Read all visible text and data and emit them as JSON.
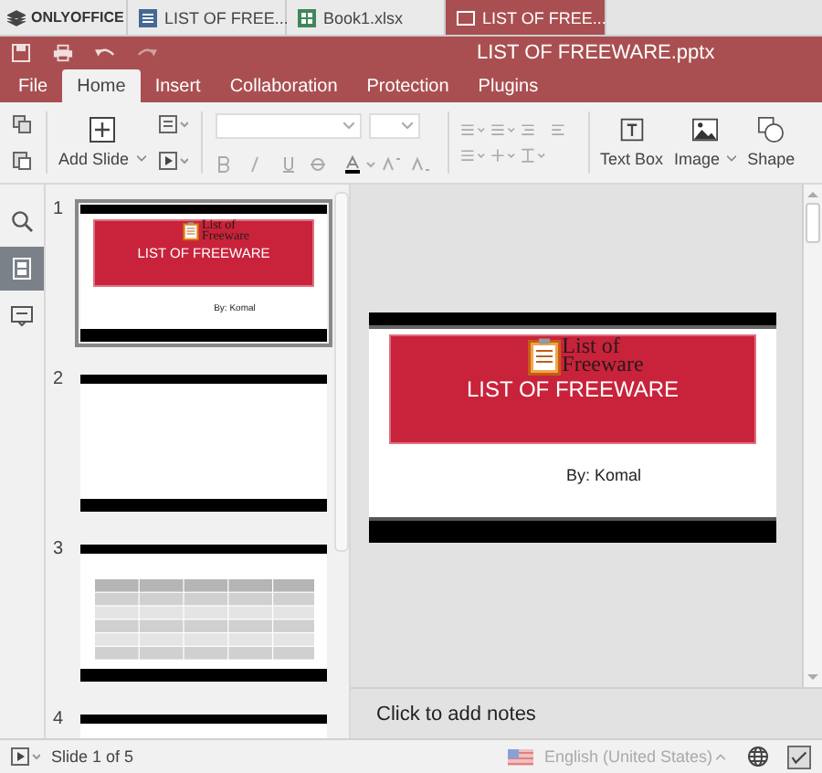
{
  "app_tabs": [
    {
      "label": "ONLYOFFICE",
      "kind": "home",
      "selected": false
    },
    {
      "label": "LIST OF FREE...",
      "kind": "document",
      "selected": false
    },
    {
      "label": "Book1.xlsx",
      "kind": "spreadsheet",
      "selected": false
    },
    {
      "label": "LIST OF FREE...",
      "kind": "presentation",
      "selected": true
    }
  ],
  "title": "LIST OF FREEWARE.pptx",
  "menu": [
    {
      "label": "File",
      "selected": false
    },
    {
      "label": "Home",
      "selected": true
    },
    {
      "label": "Insert",
      "selected": false
    },
    {
      "label": "Collaboration",
      "selected": false
    },
    {
      "label": "Protection",
      "selected": false
    },
    {
      "label": "Plugins",
      "selected": false
    }
  ],
  "toolbar": {
    "add_slide": "Add Slide",
    "text_box": "Text Box",
    "image": "Image",
    "shape": "Shape"
  },
  "side_tools": [
    {
      "kind": "search",
      "selected": false
    },
    {
      "kind": "slides",
      "selected": true
    },
    {
      "kind": "comments",
      "selected": false
    }
  ],
  "slides": [
    {
      "number": "1",
      "kind": "title",
      "selected": true,
      "logo": [
        "List of",
        "Freeware"
      ],
      "title": "LIST OF FREEWARE",
      "subtitle": "By: Komal"
    },
    {
      "number": "2",
      "kind": "blank",
      "selected": false
    },
    {
      "number": "3",
      "kind": "table",
      "selected": false
    },
    {
      "number": "4",
      "kind": "cut_off",
      "selected": false
    }
  ],
  "editor": {
    "logo": [
      "List of",
      "Freeware"
    ],
    "title": "LIST OF FREEWARE",
    "subtitle": "By: Komal"
  },
  "notes_placeholder": "Click to add notes",
  "status": {
    "slide": "Slide 1 of 5",
    "language": "English (United States)"
  }
}
